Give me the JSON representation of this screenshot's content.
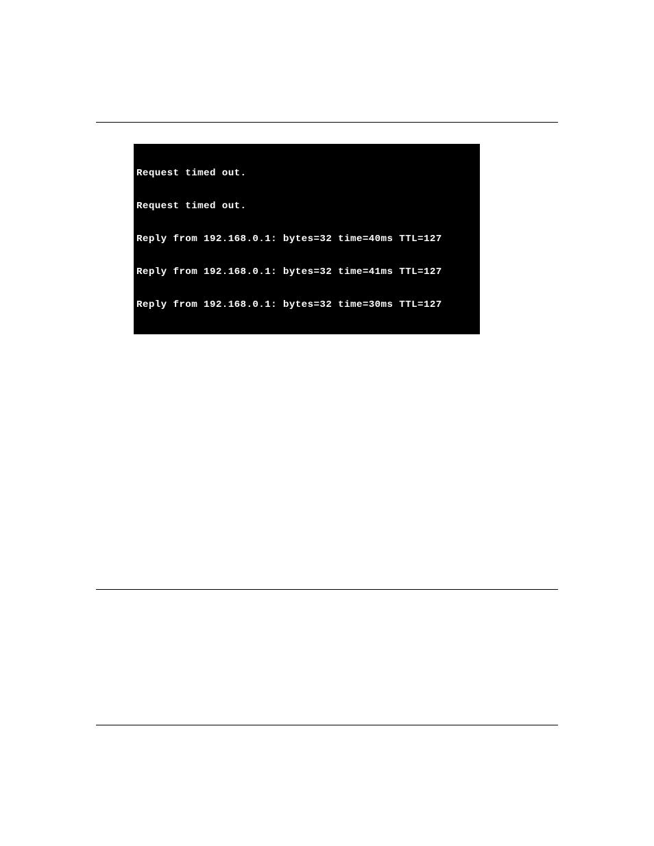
{
  "terminal": {
    "lines": [
      "Request timed out.",
      "Request timed out.",
      "Reply from 192.168.0.1: bytes=32 time=40ms TTL=127",
      "Reply from 192.168.0.1: bytes=32 time=41ms TTL=127",
      "Reply from 192.168.0.1: bytes=32 time=30ms TTL=127"
    ]
  }
}
